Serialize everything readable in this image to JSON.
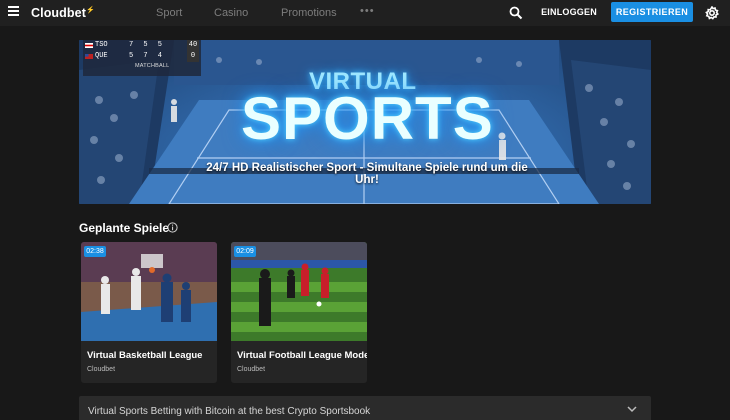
{
  "header": {
    "logo_text": "Cloudbet",
    "logo_mark": "⚡",
    "nav": [
      "Sport",
      "Casino",
      "Promotions"
    ],
    "more": "•••",
    "login_label": "EINLOGGEN",
    "register_label": "REGISTRIEREN",
    "icons": [
      "hamburger-icon",
      "search-icon",
      "gear-icon"
    ],
    "accent_color": "#1a8fe3"
  },
  "hero": {
    "scoreboard": {
      "rows": [
        {
          "team": "TSO",
          "scores": "7 5 5",
          "last": "40"
        },
        {
          "team": "QUE",
          "scores": "5 7 4",
          "last": "0"
        }
      ],
      "status": "MATCHBALL"
    },
    "kicker": "VIRTUAL",
    "headline": "SPORTS",
    "tagline": "24/7 HD Realistischer Sport - Simultane Spiele rund um die Uhr!"
  },
  "section": {
    "title": "Geplante Spiele"
  },
  "games": [
    {
      "time": "02:38",
      "title": "Virtual Basketball League",
      "provider": "Cloudbet"
    },
    {
      "time": "02:09",
      "title": "Virtual Football League Mode",
      "provider": "Cloudbet"
    }
  ],
  "footer": {
    "accordion_text": "Virtual Sports Betting with Bitcoin at the best Crypto Sportsbook"
  }
}
